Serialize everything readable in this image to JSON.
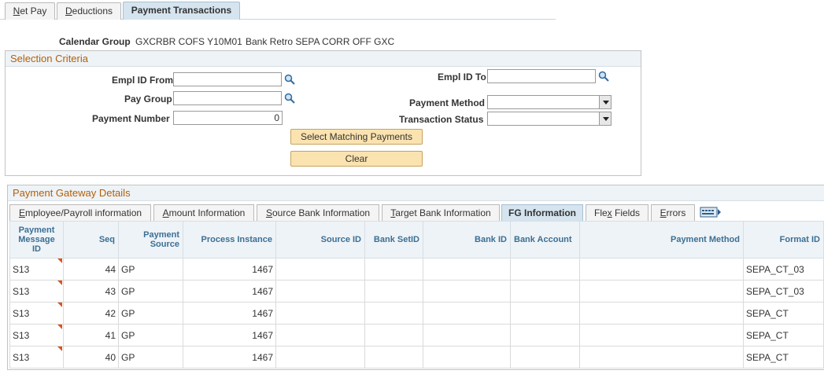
{
  "top_tabs": [
    {
      "label": "Net Pay",
      "accel": "N",
      "rest": "et Pay"
    },
    {
      "label": "Deductions",
      "accel": "D",
      "rest": "eductions"
    },
    {
      "label": "Payment Transactions",
      "active": true
    }
  ],
  "calendar": {
    "label": "Calendar Group",
    "code": "GXCRBR COFS Y10M01",
    "description": "Bank Retro SEPA CORR OFF GXC"
  },
  "criteria": {
    "title": "Selection Criteria",
    "empl_from_label": "Empl ID From",
    "empl_from_value": "",
    "empl_to_label": "Empl ID To",
    "empl_to_value": "",
    "pay_group_label": "Pay Group",
    "pay_group_value": "",
    "payment_number_label": "Payment Number",
    "payment_number_value": "0",
    "payment_method_label": "Payment Method",
    "payment_method_value": "",
    "transaction_status_label": "Transaction Status",
    "transaction_status_value": "",
    "select_btn": "Select Matching Payments",
    "clear_btn": "Clear"
  },
  "gateway": {
    "title": "Payment Gateway Details",
    "tabs": [
      {
        "pre": "",
        "accel": "E",
        "rest": "mployee/Payroll information"
      },
      {
        "pre": "",
        "accel": "A",
        "rest": "mount Information"
      },
      {
        "pre": "",
        "accel": "S",
        "rest": "ource Bank Information"
      },
      {
        "pre": "",
        "accel": "T",
        "rest": "arget Bank Information"
      },
      {
        "label": "FG Information",
        "active": true
      },
      {
        "pre": "Fle",
        "accel": "x",
        "rest": " Fields"
      },
      {
        "pre": "",
        "accel": "E",
        "rest": "rrors"
      }
    ],
    "columns": [
      "Payment Message ID",
      "Seq",
      "Payment Source",
      "Process Instance",
      "Source ID",
      "Bank SetID",
      "Bank ID",
      "Bank Account",
      "Payment Method",
      "Format ID"
    ],
    "rows": [
      {
        "msg": "S13",
        "seq": "44",
        "source": "GP",
        "instance": "1467",
        "source_id": "",
        "setid": "",
        "bank_id": "",
        "account": "",
        "method": "",
        "format": "SEPA_CT_03"
      },
      {
        "msg": "S13",
        "seq": "43",
        "source": "GP",
        "instance": "1467",
        "source_id": "",
        "setid": "",
        "bank_id": "",
        "account": "",
        "method": "",
        "format": "SEPA_CT_03"
      },
      {
        "msg": "S13",
        "seq": "42",
        "source": "GP",
        "instance": "1467",
        "source_id": "",
        "setid": "",
        "bank_id": "",
        "account": "",
        "method": "",
        "format": "SEPA_CT"
      },
      {
        "msg": "S13",
        "seq": "41",
        "source": "GP",
        "instance": "1467",
        "source_id": "",
        "setid": "",
        "bank_id": "",
        "account": "",
        "method": "",
        "format": "SEPA_CT"
      },
      {
        "msg": "S13",
        "seq": "40",
        "source": "GP",
        "instance": "1467",
        "source_id": "",
        "setid": "",
        "bank_id": "",
        "account": "",
        "method": "",
        "format": "SEPA_CT"
      }
    ]
  }
}
